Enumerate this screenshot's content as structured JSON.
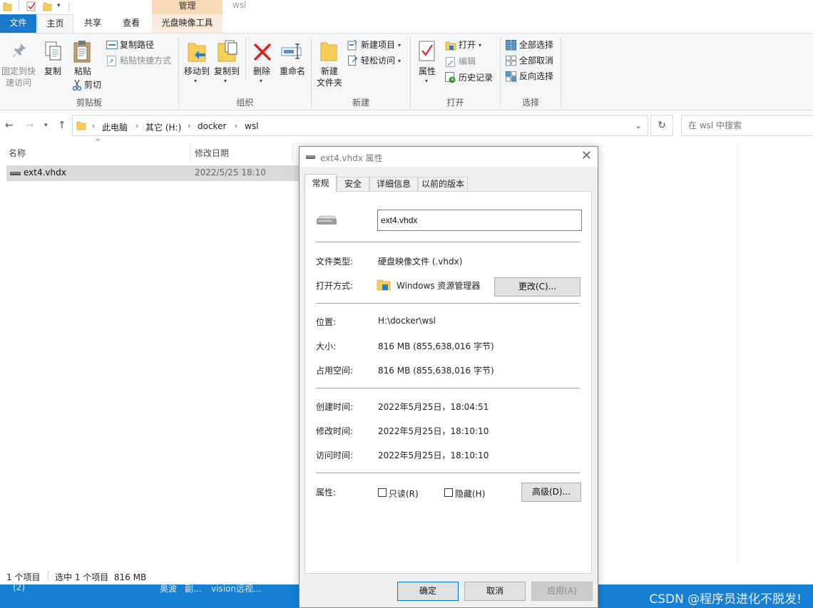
{
  "window": {
    "title": "wsl",
    "context_tab_group": "管理"
  },
  "ribbon_tabs": [
    {
      "label": "文件"
    },
    {
      "label": "主页"
    },
    {
      "label": "共享"
    },
    {
      "label": "查看"
    },
    {
      "label": "光盘映像工具"
    }
  ],
  "ribbon": {
    "clipboard": {
      "pin": "固定到快速访问",
      "pin_line1": "固定到快",
      "pin_line2": "速访问",
      "copy": "复制",
      "paste": "粘贴",
      "copy_path": "复制路径",
      "paste_shortcut": "粘贴快捷方式",
      "cut": "剪切",
      "group": "剪贴板"
    },
    "organize": {
      "move_to": "移动到",
      "copy_to": "复制到",
      "delete": "删除",
      "rename": "重命名",
      "group": "组织"
    },
    "new": {
      "new_folder_line1": "新建",
      "new_folder_line2": "文件夹",
      "new_item": "新建项目",
      "easy_access": "轻松访问",
      "group": "新建"
    },
    "open": {
      "properties": "属性",
      "open": "打开",
      "edit": "编辑",
      "history": "历史记录",
      "group": "打开"
    },
    "select": {
      "select_all": "全部选择",
      "select_none": "全部取消",
      "invert": "反向选择",
      "group": "选择"
    }
  },
  "address": {
    "crumbs": [
      "此电脑",
      "其它 (H:)",
      "docker",
      "wsl"
    ],
    "search_placeholder": "在 wsl 中搜索"
  },
  "file_list": {
    "columns": [
      "名称",
      "修改日期"
    ],
    "rows": [
      {
        "name": "ext4.vhdx",
        "modified": "2022/5/25 18:10"
      }
    ]
  },
  "status": {
    "count": "1 个项目",
    "selection": "选中 1 个项目  816 MB"
  },
  "taskbar": {
    "items": [
      "(2)",
      "奥波",
      "副...",
      "vision远视..."
    ],
    "watermark": "CSDN @程序员进化不脱发!"
  },
  "dialog": {
    "title": "ext4.vhdx 属性",
    "tabs": [
      "常规",
      "安全",
      "详细信息",
      "以前的版本"
    ],
    "filename": "ext4.vhdx",
    "fields": {
      "type_label": "文件类型:",
      "type_value": "硬盘映像文件 (.vhdx)",
      "open_with_label": "打开方式:",
      "open_with_value": "Windows 资源管理器",
      "change_button": "更改(C)...",
      "location_label": "位置:",
      "location_value": "H:\\docker\\wsl",
      "size_label": "大小:",
      "size_value": "816 MB (855,638,016 字节)",
      "disk_size_label": "占用空间:",
      "disk_size_value": "816 MB (855,638,016 字节)",
      "created_label": "创建时间:",
      "created_value": "2022年5月25日，18:04:51",
      "modified_label": "修改时间:",
      "modified_value": "2022年5月25日，18:10:10",
      "accessed_label": "访问时间:",
      "accessed_value": "2022年5月25日，18:10:10",
      "attributes_label": "属性:",
      "readonly_label": "只读(R)",
      "hidden_label": "隐藏(H)",
      "advanced_button": "高级(D)..."
    },
    "buttons": {
      "ok": "确定",
      "cancel": "取消",
      "apply": "应用(A)"
    }
  }
}
